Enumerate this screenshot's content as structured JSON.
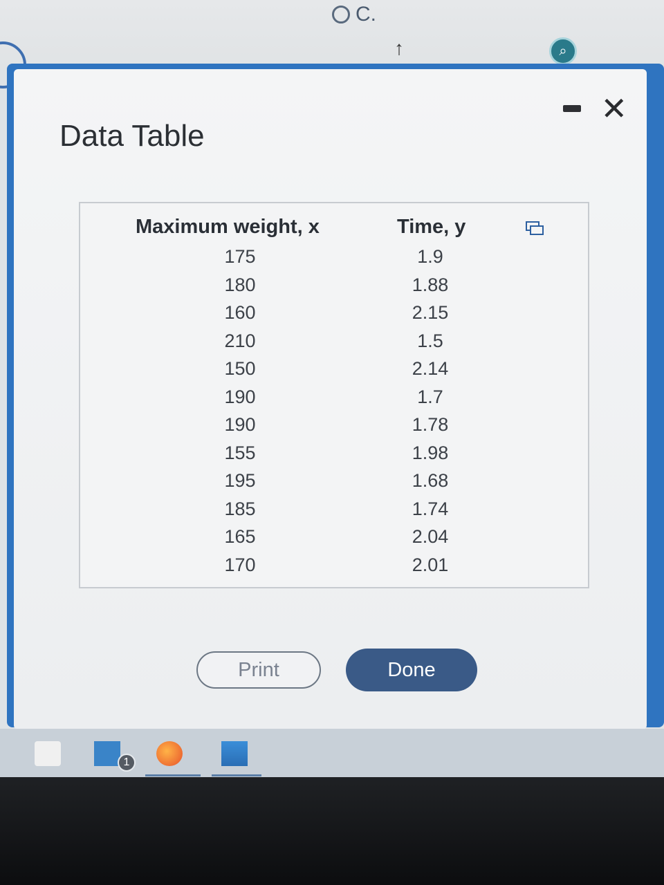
{
  "background": {
    "option_label": "C.",
    "zoom_icon": "zoom-in-icon"
  },
  "modal": {
    "title": "Data Table",
    "minimize_icon": "minimize-icon",
    "close_icon": "close-icon"
  },
  "table": {
    "columns": [
      "Maximum weight, x",
      "Time, y"
    ],
    "copy_icon": "copy-icon",
    "rows": [
      [
        "175",
        "1.9"
      ],
      [
        "180",
        "1.88"
      ],
      [
        "160",
        "2.15"
      ],
      [
        "210",
        "1.5"
      ],
      [
        "150",
        "2.14"
      ],
      [
        "190",
        "1.7"
      ],
      [
        "190",
        "1.78"
      ],
      [
        "155",
        "1.98"
      ],
      [
        "195",
        "1.68"
      ],
      [
        "185",
        "1.74"
      ],
      [
        "165",
        "2.04"
      ],
      [
        "170",
        "2.01"
      ]
    ]
  },
  "buttons": {
    "print": "Print",
    "done": "Done"
  },
  "taskbar": {
    "items": [
      "store-icon",
      "mail-icon",
      "firefox-icon",
      "photos-icon"
    ],
    "mail_badge": "1"
  },
  "colors": {
    "accent_blue": "#2f74c0",
    "done_button": "#3a5a87"
  }
}
